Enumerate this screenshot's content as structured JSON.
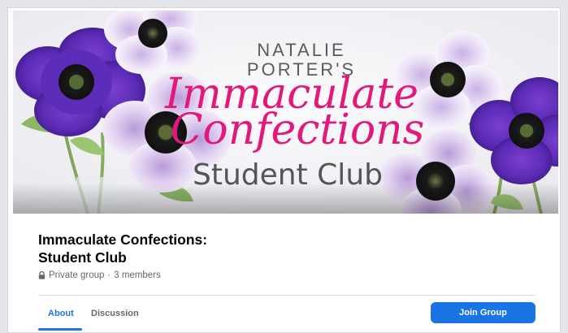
{
  "cover": {
    "title_line1": "NATALIE",
    "title_line2": "PORTER'S",
    "script_line1": "Immaculate",
    "script_line2": "Confections",
    "subtitle": "Student Club"
  },
  "group": {
    "name_line1": "Immaculate Confections:",
    "name_line2": "Student Club",
    "privacy": "Private group",
    "separator": "·",
    "members": "3 members"
  },
  "tabs": [
    {
      "label": "About",
      "active": true
    },
    {
      "label": "Discussion",
      "active": false
    }
  ],
  "actions": {
    "join_label": "Join Group"
  },
  "colors": {
    "accent": "#1b74e4",
    "script_pink": "#e0197a",
    "text_primary": "#050505",
    "text_secondary": "#65676b"
  },
  "icons": {
    "privacy": "lock-icon"
  }
}
